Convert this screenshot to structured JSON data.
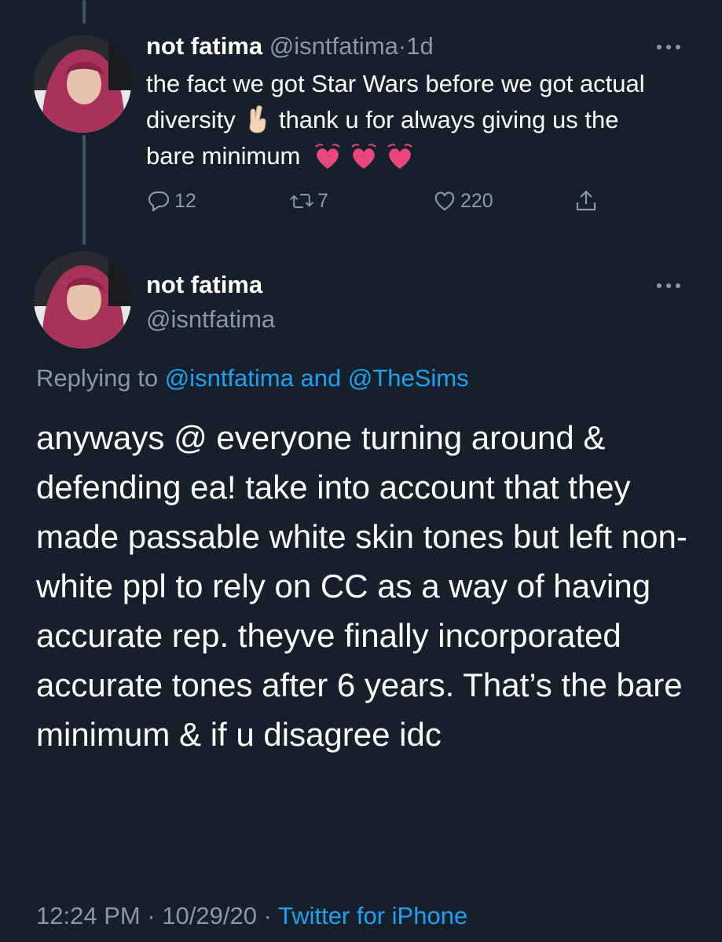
{
  "tweet1": {
    "display_name": "not fatima",
    "handle": "@isntfatima",
    "separator": "·",
    "age": "1d",
    "text_part1": "the fact we got Star Wars before we got actual diversity",
    "emoji_hand": "crossed-fingers-emoji",
    "text_part2": "thank u for always giving us the bare minimum",
    "emoji_hearts": "growing-heart-emoji",
    "reply_count": "12",
    "retweet_count": "7",
    "like_count": "220"
  },
  "tweet2": {
    "display_name": "not fatima",
    "handle": "@isntfatima",
    "replying_prefix": "Replying to",
    "replying_user1": "@isntfatima",
    "replying_and": "and",
    "replying_user2": "@TheSims",
    "text": "anyways @ everyone turning around & defending ea! take into account that they made passable white skin tones but left non-white ppl to rely on CC as a way of having accurate rep. theyve finally incorporated accurate tones after 6 years. That’s the bare minimum & if u disagree idc",
    "time": "12:24 PM",
    "dot": "·",
    "date": "10/29/20",
    "source": "Twitter for iPhone"
  },
  "colors": {
    "background": "#15202b",
    "muted": "#8899a6",
    "link": "#1da1f2",
    "thread_line": "#3d5466"
  }
}
